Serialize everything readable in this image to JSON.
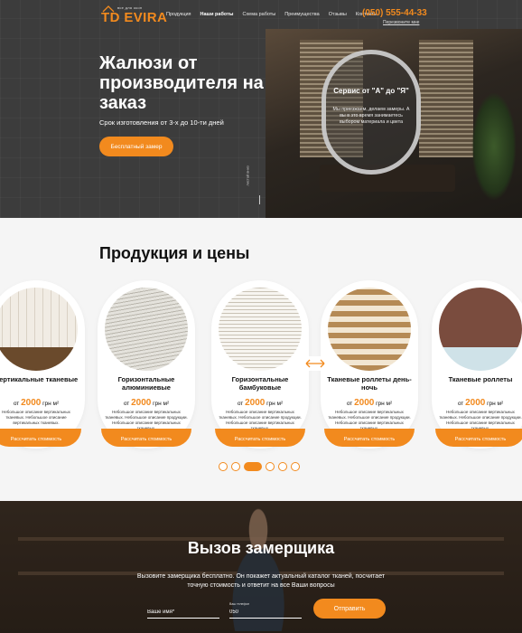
{
  "header": {
    "logo_small": "все для окон",
    "logo_text": "TD EVIRA",
    "nav": [
      "Продукция",
      "Наши работы",
      "Схема работы",
      "Преимущества",
      "Отзывы",
      "Контакты"
    ],
    "phone": "(050) 555-44-33",
    "callback": "Перезвоните мне"
  },
  "hero": {
    "title": "Жалюзи от производителя на заказ",
    "subtitle": "Срок изготовления от 3-х до 10-ти дней",
    "button": "Бесплатный замер",
    "scroll_label": "листай вниз",
    "oval_title": "Сервис от \"А\" до \"Я\"",
    "oval_text": "Мы приезжаем, делаем замеры. А вы в это время занимаетесь выбором материала и цвета"
  },
  "products": {
    "title": "Продукция и цены",
    "price_prefix": "от",
    "price_unit": "грн м²",
    "button": "Рассчитать стоимость",
    "items": [
      {
        "name": "Вертикальные тканевые",
        "price": "2000",
        "desc": "Небольшое описание вертикальных тканевых. Небольшое описание вертикальных тканевых."
      },
      {
        "name": "Горизонтальные алюминиевые",
        "price": "2000",
        "desc": "Небольшое описание вертикальных тканевых. Небольшое описание продукции. Небольшое описание вертикальных тканевых."
      },
      {
        "name": "Горизонтальные бамбуковые",
        "price": "2000",
        "desc": "Небольшое описание вертикальных тканевых. Небольшое описание продукции. Небольшое описание вертикальных тканевых."
      },
      {
        "name": "Тканевые роллеты день-ночь",
        "price": "2000",
        "desc": "Небольшое описание вертикальных тканевых. Небольшое описание продукции. Небольшое описание вертикальных тканевых."
      },
      {
        "name": "Тканевые роллеты",
        "price": "2000",
        "desc": "Небольшое описание вертикальных тканевых. Небольшое описание продукции. Небольшое описание вертикальных тканевых."
      }
    ],
    "dots": 6,
    "active_dot": 3
  },
  "measure": {
    "title": "Вызов замерщика",
    "text": "Вызовите замерщика бесплатно. Он покажет актуальный каталог тканей, посчитает точную стоимость и ответит на все Ваши вопросы",
    "name_placeholder": "Ваше имя*",
    "phone_label": "Ваш телефон",
    "phone_value": "050",
    "button": "Отправить"
  },
  "colors": {
    "accent": "#f28a1e",
    "hero_bg": "#3c3c3c",
    "section_bg": "#f5f5f5"
  }
}
